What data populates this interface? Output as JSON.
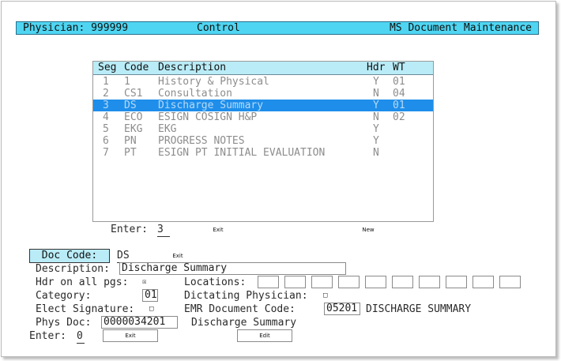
{
  "title_bar": {
    "left": "Physician: 999999",
    "center": "Control",
    "right": "MS Document Maintenance"
  },
  "list": {
    "headers": {
      "seg": "Seg",
      "code": "Code",
      "description": "Description",
      "hdr": "Hdr",
      "wt": "WT"
    },
    "rows": [
      {
        "seg": "1",
        "code": "1",
        "description": "History & Physical",
        "hdr": "Y",
        "wt": "01"
      },
      {
        "seg": "2",
        "code": "CS1",
        "description": "Consultation",
        "hdr": "N",
        "wt": "04"
      },
      {
        "seg": "3",
        "code": "DS",
        "description": "Discharge Summary",
        "hdr": "Y",
        "wt": "01"
      },
      {
        "seg": "4",
        "code": "ECO",
        "description": "ESIGN COSIGN H&P",
        "hdr": "N",
        "wt": "02"
      },
      {
        "seg": "5",
        "code": "EKG",
        "description": "EKG",
        "hdr": "Y",
        "wt": ""
      },
      {
        "seg": "6",
        "code": "PN",
        "description": "PROGRESS NOTES",
        "hdr": "Y",
        "wt": ""
      },
      {
        "seg": "7",
        "code": "PT",
        "description": "ESIGN PT INITIAL EVALUATION",
        "hdr": "N",
        "wt": ""
      }
    ],
    "selected_seg": "3"
  },
  "enter_top": {
    "label": "Enter:",
    "value": "3",
    "exit_label": "Exit",
    "new_label": "New"
  },
  "form": {
    "doc_code_label": "Doc Code:",
    "doc_code_value": "DS",
    "doc_code_exit": "Exit",
    "description_label": "Description:",
    "description_value": "Discharge Summary",
    "hdr_label": "Hdr on all pgs:",
    "hdr_check": "☒",
    "locations_label": "Locations:",
    "category_label": "Category:",
    "category_value": "01",
    "dictating_label": "Dictating Physician:",
    "dictating_check": "□",
    "elect_label": "Elect Signature:",
    "elect_check": "□",
    "emr_label": "EMR Document Code:",
    "emr_value": "05201",
    "emr_desc": "DISCHARGE SUMMARY",
    "phys_label": "Phys Doc:",
    "phys_value": "0000034201",
    "phys_desc": "Discharge Summary"
  },
  "enter_bottom": {
    "label": "Enter:",
    "value": "0",
    "exit_label": "Exit",
    "edit_label": "Edit"
  }
}
